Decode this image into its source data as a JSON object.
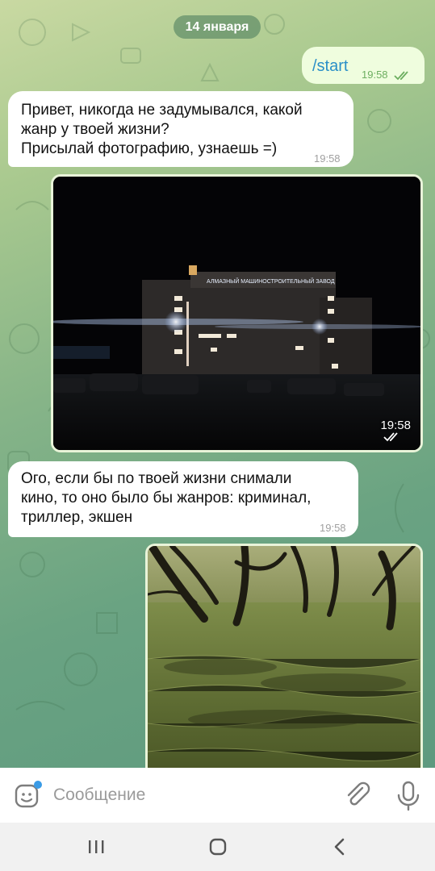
{
  "date_separator": "14 января",
  "messages": [
    {
      "direction": "outgoing",
      "text": "/start",
      "time": "19:58",
      "status": "read"
    },
    {
      "direction": "incoming",
      "text": "Привет, никогда не задумывался, какой жанр у твоей жизни? Присылай фотографию, узнаешь =)",
      "time": "19:58"
    },
    {
      "direction": "outgoing",
      "type": "photo",
      "description": "night-building",
      "time": "19:58",
      "status": "read"
    },
    {
      "direction": "incoming",
      "text": "Ого, если бы по твоей жизни снимали кино, то оно было бы жанров: криминал, триллер, экшен",
      "time": "19:58"
    },
    {
      "direction": "outgoing",
      "type": "photo",
      "description": "forest-grass"
    }
  ],
  "hello_lines": [
    "Привет, никогда не задумывался, какой",
    "жанр у твоей жизни?",
    "Присылай фотографию, узнаешь =)"
  ],
  "genre_lines": [
    "Ого, если бы по твоей жизни снимали",
    "кино, то оно было бы жанров: криминал,",
    "триллер, экшен"
  ],
  "composer": {
    "placeholder": "Сообщение"
  },
  "icons": {
    "emoji": "sticker-emoji-icon",
    "attach": "paperclip-icon",
    "mic": "microphone-icon",
    "check": "double-check-icon"
  },
  "colors": {
    "accent": "#2a8fc8",
    "outgoing_bubble": "#effdde",
    "read_check": "#6cae5f",
    "notification_dot": "#3a9be6"
  }
}
